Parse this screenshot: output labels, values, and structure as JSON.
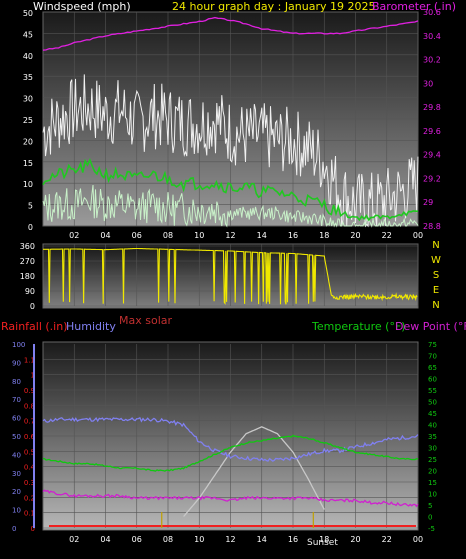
{
  "chart_data": [
    {
      "type": "line",
      "title": "24 hour graph day : January 19 2025",
      "left_axis_label": "Windspeed (mph)",
      "right_axis_label": "Barometer (.in)",
      "x_ticks": [
        "02",
        "04",
        "06",
        "08",
        "10",
        "12",
        "14",
        "16",
        "18",
        "20",
        "22",
        "00"
      ],
      "y_ticks_left": [
        "0",
        "5",
        "10",
        "15",
        "20",
        "25",
        "30",
        "35",
        "40",
        "45",
        "50"
      ],
      "y_ticks_right": [
        "28.8",
        "29",
        "29.2",
        "29.4",
        "29.6",
        "29.8",
        "30",
        "30.2",
        "30.4",
        "30.6"
      ],
      "xlim": [
        0,
        24
      ],
      "ylim_left": [
        0,
        50
      ],
      "ylim_right": [
        28.8,
        30.6
      ],
      "colors": {
        "gust": "#f0f0f0",
        "wind_avg": "#20c820",
        "wind_low": "#c8f0c8",
        "barometer": "#e020e0"
      },
      "series": [
        {
          "key": "barometer",
          "axis": "right",
          "x": [
            0,
            1,
            2,
            3,
            4,
            5,
            6,
            7,
            8,
            9,
            10,
            11,
            12,
            13,
            14,
            15,
            16,
            17,
            18,
            19,
            20,
            21,
            22,
            23,
            24
          ],
          "values": [
            30.28,
            30.3,
            30.34,
            30.37,
            30.4,
            30.42,
            30.44,
            30.46,
            30.48,
            30.5,
            30.52,
            30.55,
            30.53,
            30.5,
            30.46,
            30.44,
            30.42,
            30.42,
            30.42,
            30.42,
            30.44,
            30.46,
            30.48,
            30.5,
            30.52
          ]
        },
        {
          "key": "wind_avg",
          "axis": "left",
          "x": [
            0,
            1,
            2,
            3,
            4,
            5,
            6,
            7,
            8,
            9,
            10,
            11,
            12,
            13,
            14,
            15,
            16,
            17,
            18,
            19,
            20,
            21,
            22,
            23,
            24
          ],
          "values": [
            11,
            12,
            13,
            14,
            12,
            12,
            11,
            12,
            11,
            10,
            10,
            10,
            9,
            9,
            8,
            8,
            7,
            6,
            5,
            3,
            2,
            2,
            2,
            3,
            3
          ]
        },
        {
          "key": "gust",
          "axis": "left",
          "x": [
            0,
            1,
            2,
            3,
            4,
            5,
            6,
            7,
            8,
            9,
            10,
            11,
            12,
            13,
            14,
            15,
            16,
            17,
            18,
            19,
            20,
            21,
            22,
            23,
            24
          ],
          "values": [
            22,
            25,
            27,
            28,
            26,
            27,
            24,
            26,
            25,
            24,
            24,
            25,
            22,
            21,
            21,
            20,
            20,
            18,
            15,
            8,
            5,
            5,
            6,
            8,
            10
          ]
        },
        {
          "key": "wind_low",
          "axis": "left",
          "x": [
            0,
            1,
            2,
            3,
            4,
            5,
            6,
            7,
            8,
            9,
            10,
            11,
            12,
            13,
            14,
            15,
            16,
            17,
            18,
            19,
            20,
            21,
            22,
            23,
            24
          ],
          "values": [
            4,
            5,
            5,
            6,
            5,
            5,
            4,
            5,
            4,
            4,
            4,
            4,
            3,
            3,
            3,
            3,
            2,
            2,
            1,
            0,
            0,
            0,
            0,
            0,
            1
          ]
        }
      ]
    },
    {
      "type": "scatter",
      "y_ticks": [
        "0",
        "90",
        "180",
        "270",
        "360"
      ],
      "compass": [
        "N",
        "W",
        "S",
        "E",
        "N"
      ],
      "ylim": [
        0,
        360
      ],
      "color": "#f0e800",
      "series": [
        {
          "key": "wind_direction",
          "x": [
            0,
            2,
            4,
            6,
            8,
            10,
            12,
            14,
            16,
            18,
            18.5,
            20,
            22,
            24
          ],
          "values": [
            340,
            342,
            338,
            345,
            340,
            335,
            330,
            320,
            315,
            300,
            40,
            60,
            65,
            55
          ]
        }
      ]
    },
    {
      "type": "line",
      "left_axis_label_rain": "Rainfall (.in)",
      "left_axis_label_hum": "Humidity",
      "solar_label": "Max solar",
      "right_axis_label_temp": "Temperature (°F)",
      "right_axis_label_dew": "Dew Point (°F)",
      "sunset_label": "Sunset",
      "y_ticks_humidity": [
        "0",
        "10",
        "20",
        "30",
        "40",
        "50",
        "60",
        "70",
        "80",
        "90",
        "100"
      ],
      "y_ticks_rain": [
        "0",
        "0.1",
        "0.2",
        "0.3",
        "0.4",
        "0.5",
        "0.6",
        "0.7",
        "0.8",
        "0.9",
        "1",
        "1.1"
      ],
      "y_ticks_temp": [
        "-5",
        "0",
        "5",
        "10",
        "15",
        "20",
        "25",
        "30",
        "35",
        "40",
        "45",
        "50",
        "55",
        "60",
        "65",
        "70",
        "75"
      ],
      "x_ticks": [
        "02",
        "04",
        "06",
        "08",
        "10",
        "12",
        "14",
        "16",
        "18",
        "20",
        "22",
        "00"
      ],
      "ylim_humidity": [
        0,
        100
      ],
      "ylim_temp": [
        -5,
        75
      ],
      "colors": {
        "humidity": "#8080f0",
        "temperature": "#10c810",
        "dew_point": "#d020d0",
        "rain": "#f02020",
        "solar": "#c8c8c8",
        "sunset": "#c0a000"
      },
      "series": [
        {
          "key": "humidity",
          "x": [
            0,
            1,
            2,
            3,
            4,
            5,
            6,
            7,
            8,
            9,
            10,
            11,
            12,
            13,
            14,
            15,
            16,
            17,
            18,
            19,
            20,
            21,
            22,
            23,
            24
          ],
          "values": [
            58,
            59,
            59,
            59,
            59,
            59,
            59,
            59,
            58,
            56,
            47,
            42,
            39,
            38,
            37,
            37,
            38,
            40,
            42,
            42,
            44,
            46,
            48,
            49,
            50
          ]
        },
        {
          "key": "temperature",
          "x": [
            0,
            1,
            2,
            3,
            4,
            5,
            6,
            7,
            8,
            9,
            10,
            11,
            12,
            13,
            14,
            15,
            16,
            17,
            18,
            19,
            20,
            21,
            22,
            23,
            24
          ],
          "values": [
            25,
            24,
            23,
            23,
            22,
            21,
            21,
            20,
            20,
            21,
            24,
            27,
            30,
            32,
            33,
            34,
            35,
            34,
            32,
            30,
            28,
            27,
            26,
            25,
            25
          ]
        },
        {
          "key": "dew_point",
          "x": [
            0,
            1,
            2,
            3,
            4,
            5,
            6,
            7,
            8,
            9,
            10,
            11,
            12,
            13,
            14,
            15,
            16,
            17,
            18,
            19,
            20,
            21,
            22,
            23,
            24
          ],
          "values": [
            11,
            10,
            9,
            9,
            9,
            9,
            8,
            8,
            8,
            8,
            8,
            8,
            7,
            8,
            8,
            8,
            8,
            8,
            7,
            7,
            7,
            6,
            6,
            5,
            5
          ]
        },
        {
          "key": "max_solar",
          "x": [
            9,
            10,
            11,
            12,
            13,
            14,
            15,
            16,
            17,
            18
          ],
          "values": [
            0,
            8,
            18,
            28,
            36,
            39,
            36,
            28,
            16,
            3
          ]
        }
      ],
      "sunset_hour": 17.3
    }
  ]
}
